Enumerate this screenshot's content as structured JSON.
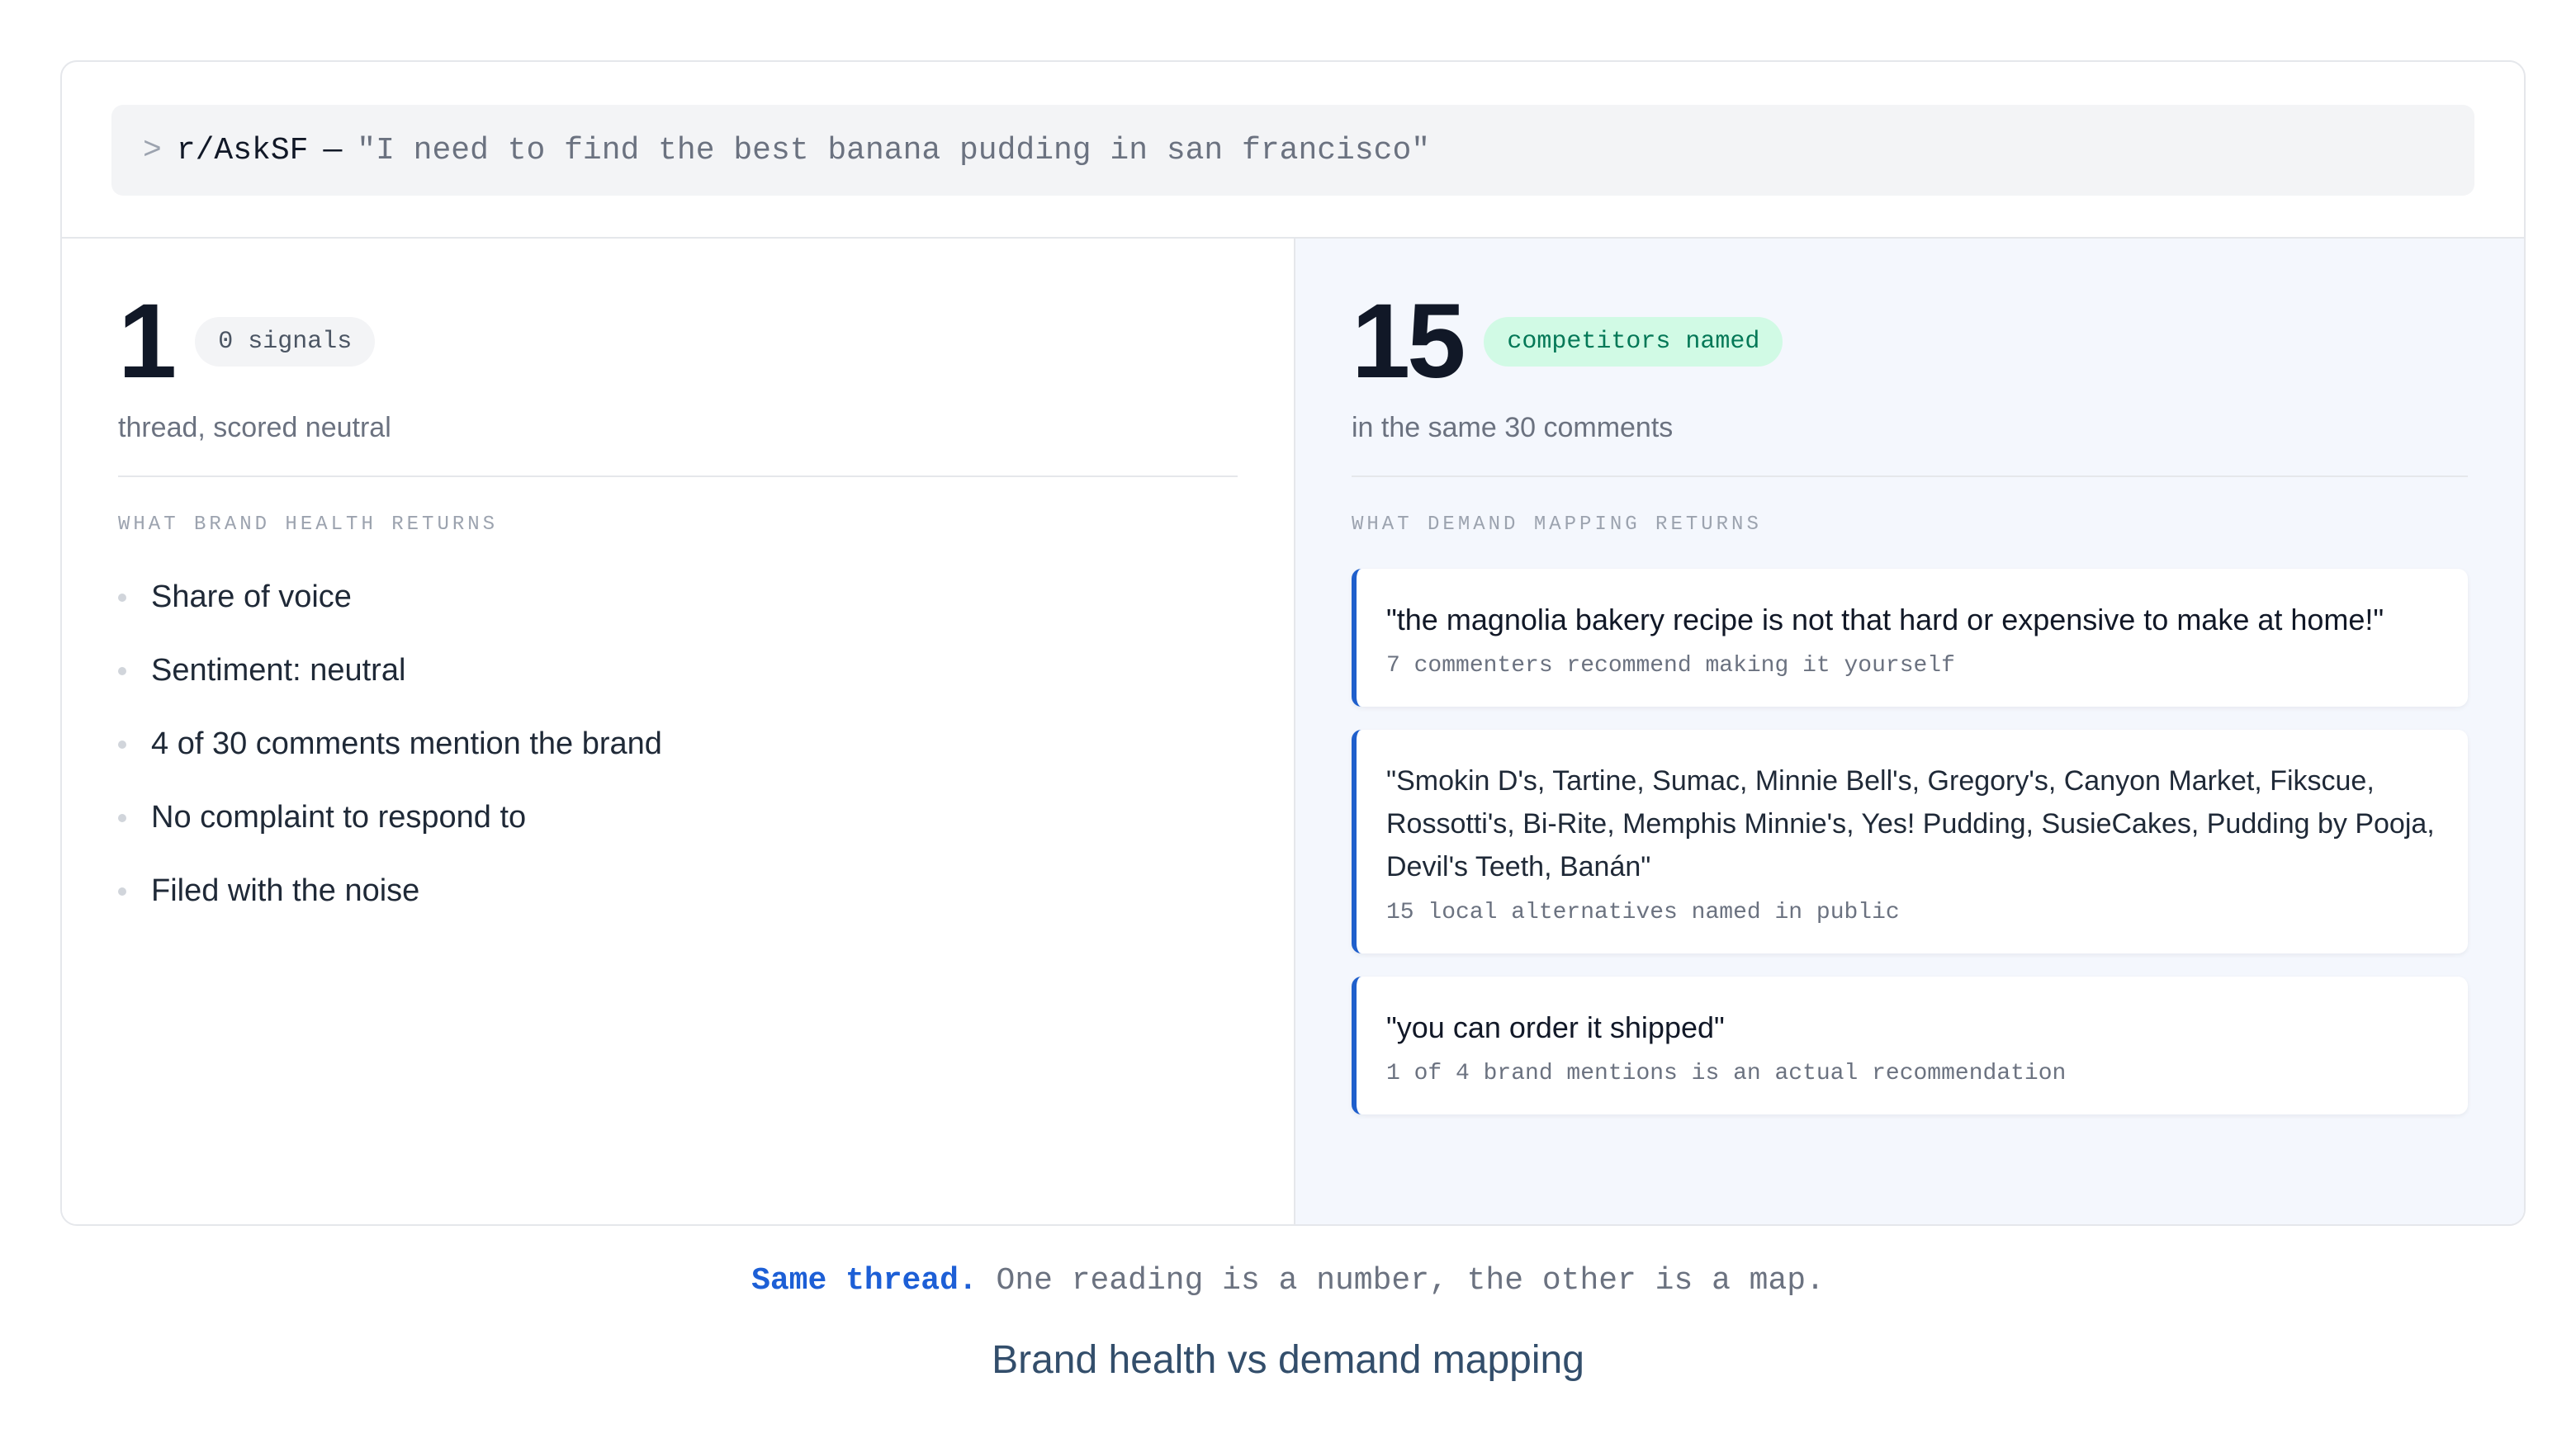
{
  "prompt": {
    "caret": ">",
    "subreddit": "r/AskSF",
    "dash": "—",
    "query": "\"I need to find the best banana pudding in san francisco\""
  },
  "left": {
    "number": "1",
    "badge": "0 signals",
    "subtitle": "thread, scored neutral",
    "section_label": "WHAT BRAND HEALTH RETURNS",
    "items": [
      "Share of voice",
      "Sentiment: neutral",
      "4 of 30 comments mention the brand",
      "No complaint to respond to",
      "Filed with the noise"
    ]
  },
  "right": {
    "number": "15",
    "badge": "competitors named",
    "subtitle": "in the same 30 comments",
    "section_label": "WHAT DEMAND MAPPING RETURNS",
    "cards": [
      {
        "quote": "\"the magnolia bakery recipe is not that hard or expensive to make at home!\"",
        "meta": "7 commenters recommend making it yourself"
      },
      {
        "quote": "\"Smokin D's, Tartine, Sumac, Minnie Bell's, Gregory's, Canyon Market, Fikscue, Rossotti's, Bi-Rite, Memphis Minnie's, Yes! Pudding, SusieCakes, Pudding by Pooja, Devil's Teeth, Banán\"",
        "meta": "15 local alternatives named in public"
      },
      {
        "quote": "\"you can order it shipped\"",
        "meta": "1 of 4 brand mentions is an actual recommendation"
      }
    ]
  },
  "caption": {
    "accent": "Same thread.",
    "rest": " One reading is a number, the other is a map."
  },
  "footer_title": "Brand health vs demand mapping",
  "colors": {
    "accent_blue": "#1d5fd6",
    "badge_green_bg": "#d1fae5",
    "badge_green_text": "#047857",
    "right_panel_bg": "#f4f7fd"
  }
}
